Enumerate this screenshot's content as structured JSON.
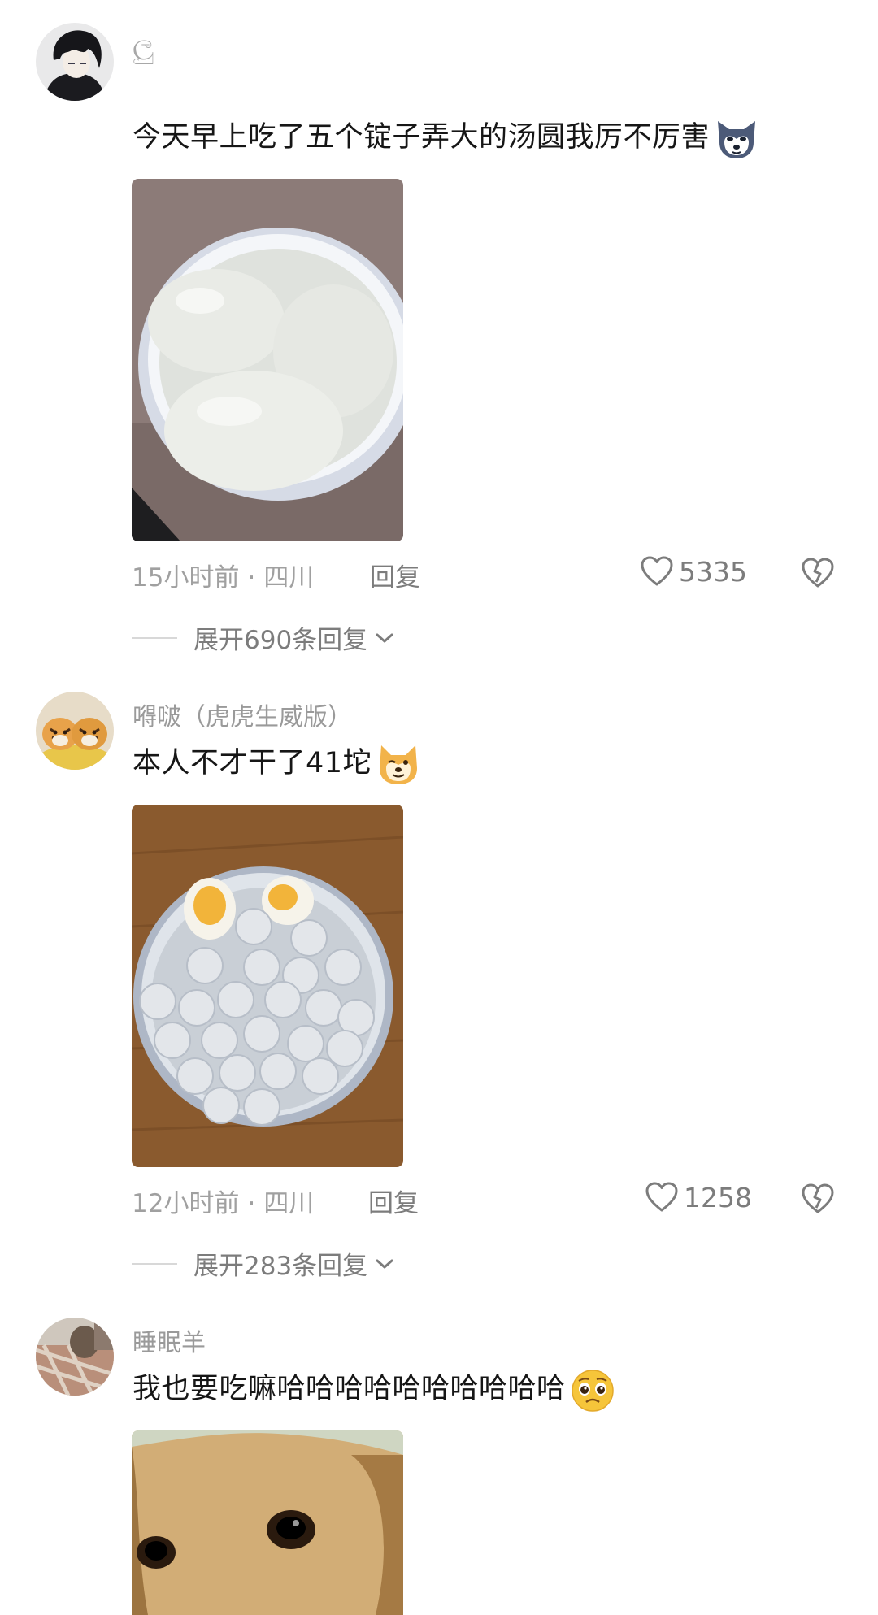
{
  "comments": [
    {
      "username": "",
      "username_glyph": "ලු",
      "text": "今天早上吃了五个锭子弄大的汤圆我厉不厉害",
      "emoji": "wolf-face-emoji",
      "photo": "bowl-of-three-large-tangyuan",
      "time": "15小时前",
      "location": "四川",
      "reply_label": "回复",
      "likes": "5335",
      "expand_label": "展开690条回复"
    },
    {
      "username": "嘚啵（虎虎生威版）",
      "text": "本人不才干了41坨",
      "emoji": "doge-emoji",
      "photo": "bowl-of-small-tangyuan-with-eggs",
      "time": "12小时前",
      "location": "四川",
      "reply_label": "回复",
      "likes": "1258",
      "expand_label": "展开283条回复"
    },
    {
      "username": "睡眠羊",
      "text": "我也要吃嘛哈哈哈哈哈哈哈哈哈哈",
      "emoji": "pleading-face-emoji",
      "photo": "golden-retriever-puppy"
    }
  ],
  "colors": {
    "text": "#161616",
    "muted": "#a0a0a0",
    "icon": "#7c7c7c"
  }
}
